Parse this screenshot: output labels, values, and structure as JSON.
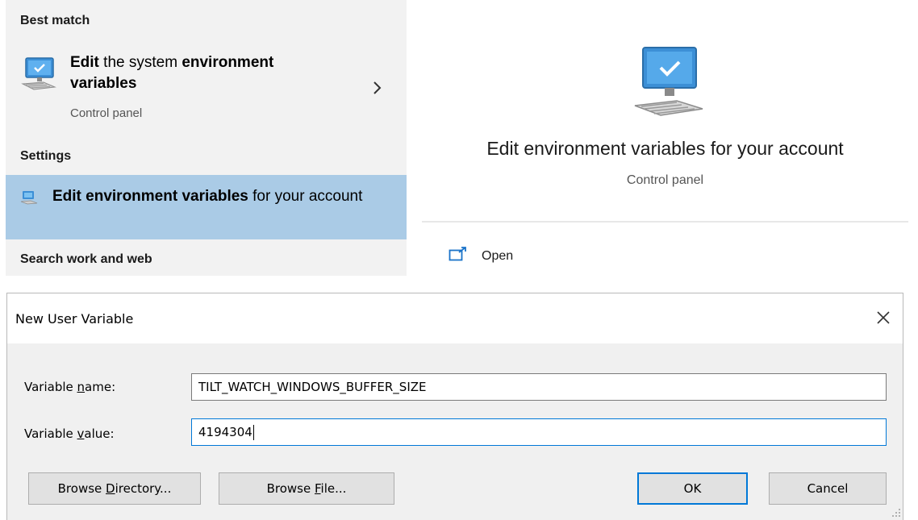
{
  "start_search": {
    "best_match_header": "Best match",
    "best_match": {
      "title_bold_1": "Edit",
      "title_plain_1": " the system ",
      "title_bold_2": "environment variables",
      "subtitle": "Control panel",
      "icon": "system-properties-icon"
    },
    "settings_header": "Settings",
    "settings_item": {
      "title_bold": "Edit environment variables",
      "title_plain": " for your account",
      "icon": "system-icon"
    },
    "web_header": "Search work and web",
    "preview": {
      "title": "Edit environment variables for your account",
      "subtitle": "Control panel",
      "open_label": "Open"
    }
  },
  "dialog": {
    "title": "New User Variable",
    "name_label_pre": "Variable ",
    "name_label_ul": "n",
    "name_label_post": "ame:",
    "name_value": "TILT_WATCH_WINDOWS_BUFFER_SIZE",
    "value_label_pre": "Variable ",
    "value_label_ul": "v",
    "value_label_post": "alue:",
    "value_value": "4194304",
    "browse_dir_pre": "Browse ",
    "browse_dir_ul": "D",
    "browse_dir_post": "irectory...",
    "browse_file_pre": "Browse ",
    "browse_file_ul": "F",
    "browse_file_post": "ile...",
    "ok_label": "OK",
    "cancel_label": "Cancel"
  },
  "colors": {
    "selected_item_bg": "#aacbe6",
    "results_bg": "#f2f2f2",
    "accent": "#0078d7",
    "dialog_bg": "#f0f0f0"
  }
}
